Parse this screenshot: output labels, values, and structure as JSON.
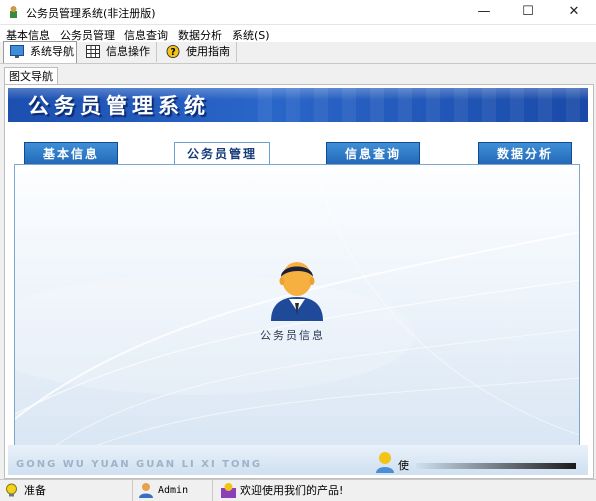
{
  "window": {
    "title": "公务员管理系统(非注册版)",
    "controls": {
      "minimize": "—",
      "maximize": "☐",
      "close": "✕"
    }
  },
  "menu": [
    "基本信息",
    "公务员管理",
    "信息查询",
    "数据分析",
    "系统(S)"
  ],
  "toolbar": [
    {
      "label": "系统导航",
      "icon": "monitor-icon"
    },
    {
      "label": "信息操作",
      "icon": "grid-icon"
    },
    {
      "label": "使用指南",
      "icon": "help-icon"
    }
  ],
  "subtab": "图文导航",
  "banner": {
    "title": "公务员管理系统"
  },
  "nav_tabs": [
    "基本信息",
    "公务员管理",
    "信息查询",
    "数据分析"
  ],
  "active_nav": "公务员管理",
  "panel": {
    "icon_label": "公务员信息",
    "icon": "user-avatar-icon"
  },
  "footer": {
    "pinyin": "GONG WU YUAN GUAN LI XI TONG",
    "use_char": "使"
  },
  "status": {
    "ready": "准备",
    "user": "Admin",
    "message": "欢迎使用我们的产品!"
  },
  "colors": {
    "banner": "#2a66c9",
    "tab": "#2267b7",
    "panel_border": "#7fa6cf"
  }
}
